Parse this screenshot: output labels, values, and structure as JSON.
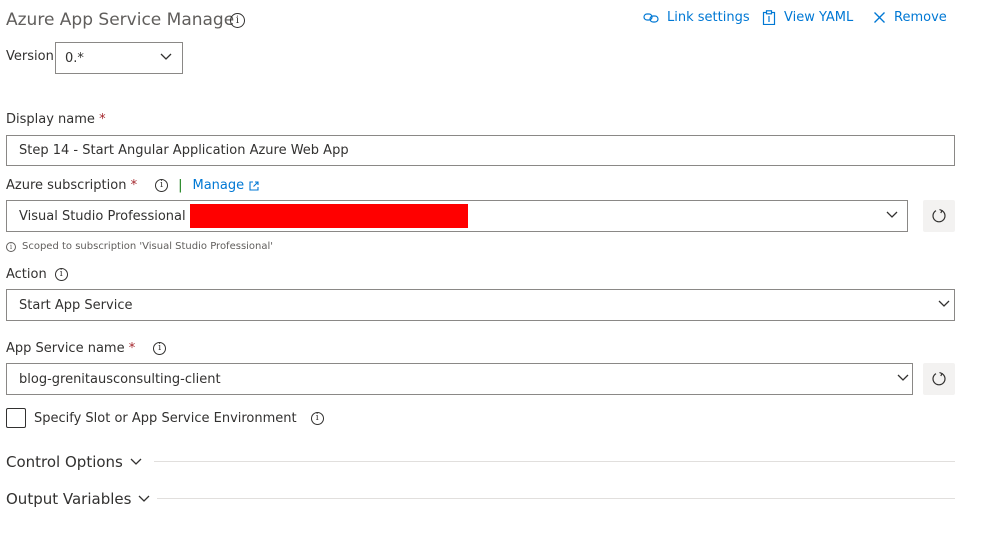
{
  "header": {
    "title": "Azure App Service Manage",
    "actions": {
      "link_settings": "Link settings",
      "view_yaml": "View YAML",
      "remove": "Remove"
    }
  },
  "version": {
    "label": "Version",
    "value": "0.*"
  },
  "display_name": {
    "label": "Display name",
    "required": "*",
    "value": "Step 14 - Start Angular Application Azure Web App"
  },
  "subscription": {
    "label": "Azure subscription",
    "required": "*",
    "separator": "|",
    "manage_link": "Manage",
    "value": "Visual Studio Professional",
    "redacted_color": "#ff0000",
    "scope_hint": "Scoped to subscription 'Visual Studio Professional'"
  },
  "action": {
    "label": "Action",
    "value": "Start App Service"
  },
  "app_service_name": {
    "label": "App Service name",
    "required": "*",
    "value": "blog-grenitausconsulting-client"
  },
  "slot_checkbox": {
    "label": "Specify Slot or App Service Environment",
    "checked": false
  },
  "sections": {
    "control_options": "Control Options",
    "output_variables": "Output Variables"
  },
  "icons": {
    "info": "i"
  },
  "colors": {
    "accent": "#0078d4",
    "required": "#a4262c",
    "border": "#8a8886"
  }
}
